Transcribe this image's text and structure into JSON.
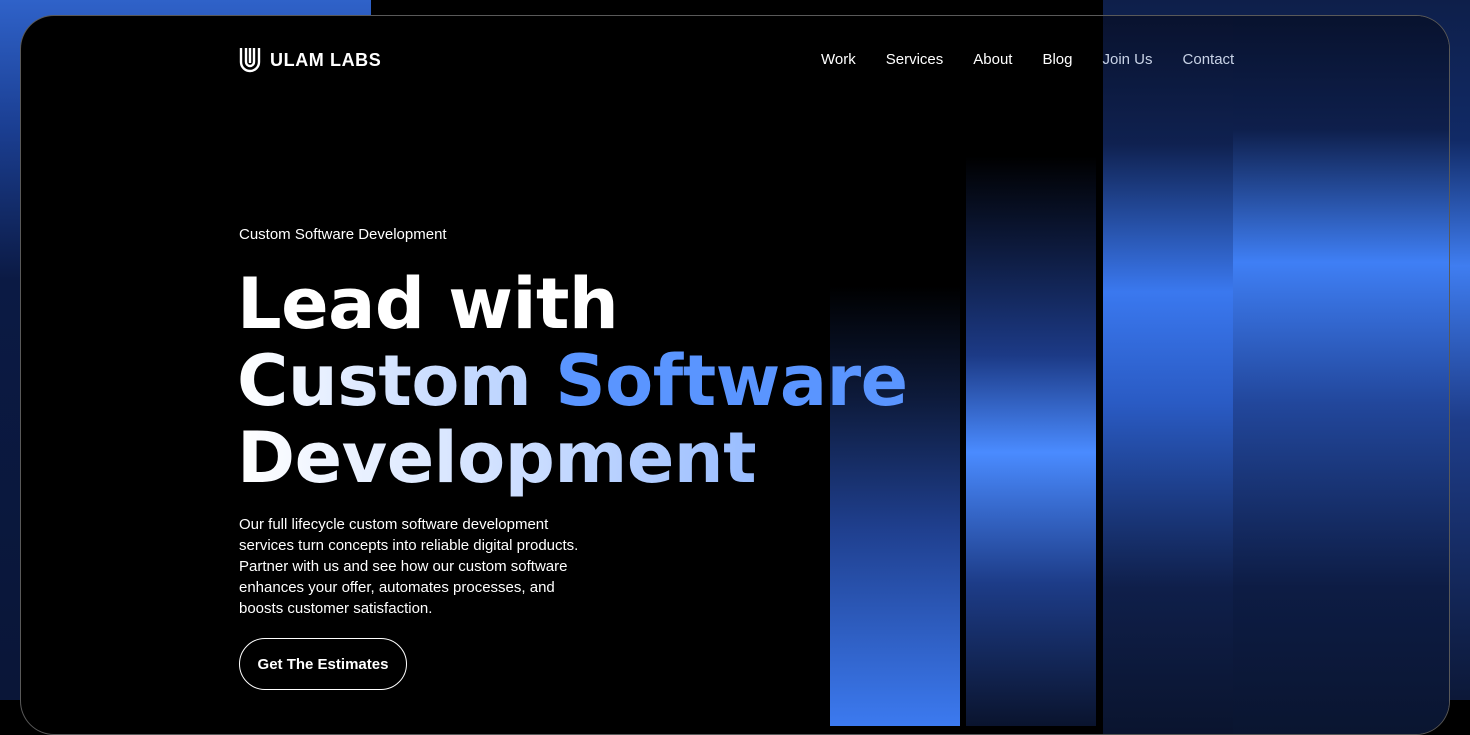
{
  "brand": {
    "name": "ULAM LABS",
    "logo_icon": "u-letter-logo-icon"
  },
  "nav": {
    "links": [
      {
        "label": "Work"
      },
      {
        "label": "Services"
      },
      {
        "label": "About"
      },
      {
        "label": "Blog"
      },
      {
        "label": "Join Us"
      },
      {
        "label": "Contact"
      }
    ]
  },
  "hero": {
    "eyebrow": "Custom Software Development",
    "headline_line1": "Lead with",
    "headline_line2_a": "Custom",
    "headline_line2_b": "Software",
    "headline_line3": "Development",
    "description": "Our full lifecycle custom software development services turn concepts into reliable digital products. Partner with us and see how our custom software enhances your offer, automates processes, and boosts customer satisfaction.",
    "cta_label": "Get The Estimates"
  },
  "colors": {
    "background": "#000000",
    "accent_blue": "#5a95ff",
    "gradient_blue": "#3f7ff5"
  }
}
